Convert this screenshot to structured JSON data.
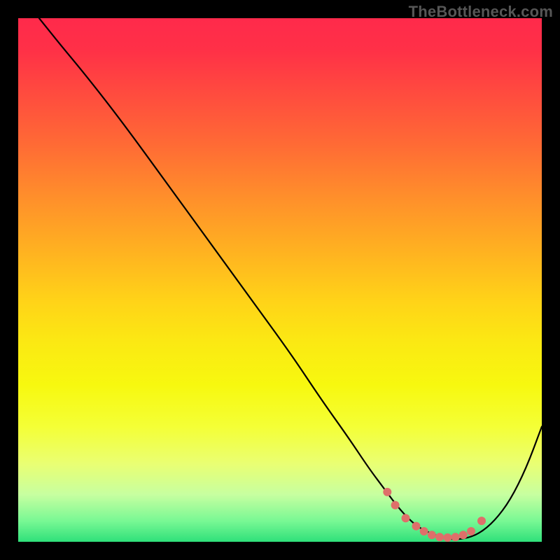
{
  "watermark": "TheBottleneck.com",
  "chart_data": {
    "type": "line",
    "title": "",
    "xlabel": "",
    "ylabel": "",
    "xlim": [
      0,
      100
    ],
    "ylim": [
      0,
      100
    ],
    "series": [
      {
        "name": "bottleneck-curve",
        "x": [
          4,
          8,
          13,
          20,
          28,
          36,
          44,
          52,
          58,
          63,
          67,
          70,
          73,
          76,
          79,
          82,
          85,
          88,
          91,
          94,
          97,
          100
        ],
        "y": [
          100,
          95,
          89,
          80,
          69,
          58,
          47,
          36,
          27,
          20,
          14,
          10,
          6,
          3,
          1.5,
          0.5,
          0.5,
          1.5,
          4,
          8,
          14,
          22
        ]
      }
    ],
    "markers": {
      "name": "optimal-range-dots",
      "x": [
        70.5,
        72,
        74,
        76,
        77.5,
        79,
        80.5,
        82,
        83.5,
        85,
        86.5,
        88.5
      ],
      "y": [
        9.5,
        7,
        4.5,
        3,
        2,
        1.3,
        0.9,
        0.8,
        0.9,
        1.3,
        2,
        4
      ],
      "color": "#de6f6a",
      "radius": 6
    },
    "gradient_stops": [
      {
        "pos": 0,
        "color": "#ff2a4b"
      },
      {
        "pos": 50,
        "color": "#ffd318"
      },
      {
        "pos": 78,
        "color": "#f4ff36"
      },
      {
        "pos": 100,
        "color": "#2fe07a"
      }
    ]
  }
}
